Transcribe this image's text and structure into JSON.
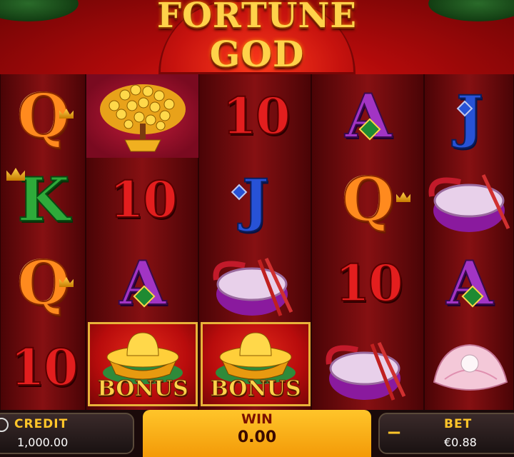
{
  "game": {
    "title_line1": "FORTUNE",
    "title_line2": "GOD"
  },
  "reels": [
    {
      "symbols": [
        "Q",
        "K",
        "Q",
        "10"
      ]
    },
    {
      "symbols": [
        "money-tree",
        "10",
        "A",
        "bonus-gold-ingot"
      ]
    },
    {
      "symbols": [
        "10",
        "J",
        "drum",
        "bonus-gold-ingot"
      ]
    },
    {
      "symbols": [
        "A",
        "Q",
        "10",
        "drum"
      ]
    },
    {
      "symbols": [
        "J",
        "drum",
        "A",
        "pearl-shell"
      ]
    }
  ],
  "labels": {
    "bonus": "BONUS"
  },
  "bottom_bar": {
    "credit_label": "CREDIT",
    "credit_value": "1,000.00",
    "win_label": "WIN",
    "win_value": "0.00",
    "bet_label": "BET",
    "bet_value": "€0.88",
    "minus_label": "−"
  },
  "colors": {
    "gold": "#ffd24a",
    "background_red": "#b10a0a",
    "win_panel": "#ffc52a"
  }
}
